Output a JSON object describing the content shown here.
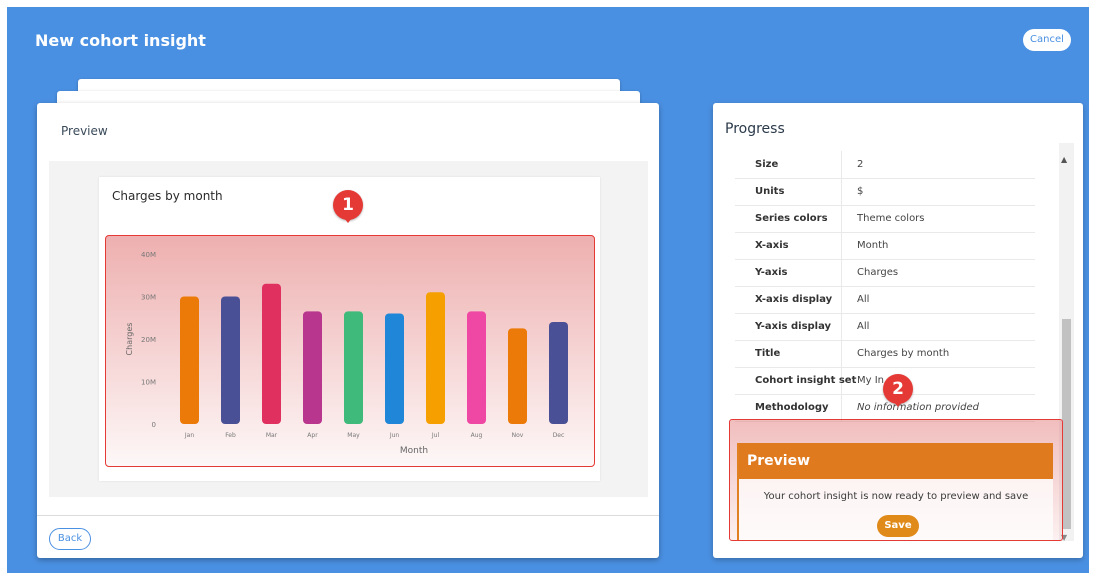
{
  "header": {
    "title": "New cohort insight",
    "cancel_label": "Cancel"
  },
  "preview_panel": {
    "heading": "Preview",
    "back_label": "Back",
    "badge_number": "1"
  },
  "chart_data": {
    "type": "bar",
    "title": "Charges by month",
    "xlabel": "Month",
    "ylabel": "Charges",
    "categories": [
      "Jan",
      "Feb",
      "Mar",
      "Apr",
      "May",
      "Jun",
      "Jul",
      "Aug",
      "Nov",
      "Dec"
    ],
    "values": [
      30,
      30,
      33,
      26.5,
      26.5,
      26,
      31,
      26.5,
      22.5,
      24
    ],
    "ylim": [
      0,
      40
    ],
    "yticks": [
      "0",
      "10M",
      "20M",
      "30M",
      "40M"
    ],
    "ytick_values": [
      0,
      10,
      20,
      30,
      40
    ],
    "bar_colors": [
      "#ec7a08",
      "#4a5096",
      "#e03060",
      "#b8368e",
      "#3fba7a",
      "#1f86d8",
      "#f5a000",
      "#ef47a4",
      "#ec7a08",
      "#4a5096"
    ],
    "grid": false,
    "legend": "none"
  },
  "progress": {
    "title": "Progress",
    "badge_number": "2",
    "rows": [
      {
        "label": "Size",
        "value": "2"
      },
      {
        "label": "Units",
        "value": "$"
      },
      {
        "label": "Series colors",
        "value": "Theme colors"
      },
      {
        "label": "X-axis",
        "value": "Month"
      },
      {
        "label": "Y-axis",
        "value": "Charges"
      },
      {
        "label": "X-axis display",
        "value": "All"
      },
      {
        "label": "Y-axis display",
        "value": "All"
      },
      {
        "label": "Title",
        "value": "Charges by month"
      },
      {
        "label": "Cohort insight set",
        "value": "My In"
      },
      {
        "label": "Methodology",
        "value": "No information provided"
      }
    ],
    "preview_box": {
      "heading": "Preview",
      "text": "Your cohort insight is now ready to preview and save",
      "save_label": "Save"
    }
  }
}
